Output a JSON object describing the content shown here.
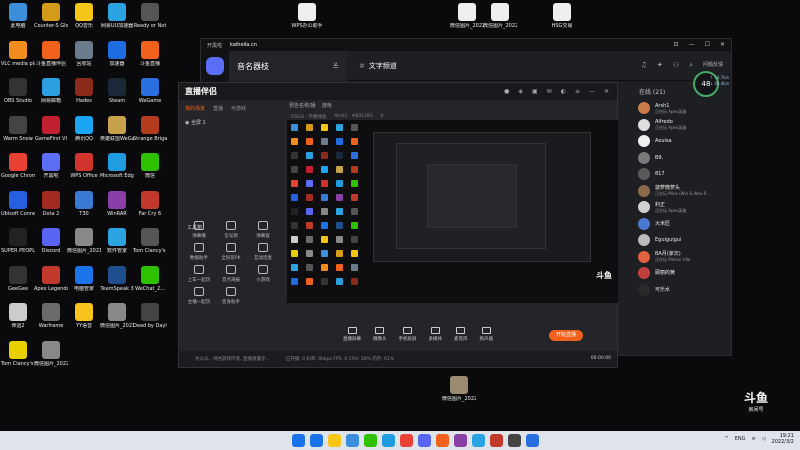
{
  "desktop": {
    "icons": [
      {
        "label": "此电脑",
        "color": "#3b8ed9"
      },
      {
        "label": "Counter-S Global Off...",
        "color": "#d49b1a"
      },
      {
        "label": "QQ音乐",
        "color": "#f5c518"
      },
      {
        "label": "网易UU加速器",
        "color": "#2aa3e0"
      },
      {
        "label": "Ready or Not",
        "color": "#555"
      },
      {
        "label": "VLC media player",
        "color": "#f28c1e"
      },
      {
        "label": "斗鱼直播伴侣",
        "color": "#f0611c"
      },
      {
        "label": "回收站",
        "color": "#6a7b8e"
      },
      {
        "label": "加速器",
        "color": "#1e6de0"
      },
      {
        "label": "斗鱼直播",
        "color": "#f0611c"
      },
      {
        "label": "OBS Studio",
        "color": "#333"
      },
      {
        "label": "网易邮箱",
        "color": "#2b9fe0"
      },
      {
        "label": "Hades",
        "color": "#8a2a1a"
      },
      {
        "label": "Steam",
        "color": "#1b2838"
      },
      {
        "label": "WeGame",
        "color": "#2a6fe0"
      },
      {
        "label": "Warm Snow",
        "color": "#444"
      },
      {
        "label": "GameFirst VI",
        "color": "#c02030"
      },
      {
        "label": "腾讯QQ",
        "color": "#1ba5f5"
      },
      {
        "label": "英雄联盟WeGame版",
        "color": "#c8a24a"
      },
      {
        "label": "Strange Brigade",
        "color": "#b43c1e"
      },
      {
        "label": "Google Chrome",
        "color": "#e94235"
      },
      {
        "label": "开黑啦",
        "color": "#5b6ef5"
      },
      {
        "label": "WPS Office",
        "color": "#d0342c"
      },
      {
        "label": "Microsoft Edge",
        "color": "#1f9de0"
      },
      {
        "label": "微信",
        "color": "#2dc100"
      },
      {
        "label": "Ubisoft Connect",
        "color": "#2560e0"
      },
      {
        "label": "Dota 2",
        "color": "#a32a20"
      },
      {
        "label": "T30",
        "color": "#3a7bd5"
      },
      {
        "label": "WinRAR",
        "color": "#8a3fa6"
      },
      {
        "label": "Far Cry 6",
        "color": "#c0392b"
      },
      {
        "label": "SUPER PEOPLE CBT",
        "color": "#222"
      },
      {
        "label": "Discord",
        "color": "#5865f2"
      },
      {
        "label": "微信图片_2021112...",
        "color": "#888"
      },
      {
        "label": "软件管家",
        "color": "#2aa3e0"
      },
      {
        "label": "Tom Clancy's R...",
        "color": "#555"
      },
      {
        "label": "GeeGee",
        "color": "#333"
      },
      {
        "label": "Apex Legends",
        "color": "#c0392b"
      },
      {
        "label": "电脑管家",
        "color": "#1a73e8"
      },
      {
        "label": "TeamSpeak 3",
        "color": "#1f4e8c"
      },
      {
        "label": "WeChat_2...",
        "color": "#2dc100"
      },
      {
        "label": "命运2",
        "color": "#ccc"
      },
      {
        "label": "Warframe",
        "color": "#6a6a6a"
      },
      {
        "label": "YY语音",
        "color": "#f6c21c"
      },
      {
        "label": "微信图片_2021120...",
        "color": "#888"
      },
      {
        "label": "Dead by Daylight",
        "color": "#444"
      },
      {
        "label": "Tom Clancy's R...",
        "color": "#e8d000"
      },
      {
        "label": "微信图片_2022020...",
        "color": "#888"
      }
    ],
    "top_files": [
      {
        "label": "WPS办公助手"
      },
      {
        "label": "微信图片_2022030..."
      },
      {
        "label": "微信图片_2022030..."
      },
      {
        "label": "HSG交易"
      }
    ],
    "bottom_file": {
      "label": "微信图片_2022020..."
    },
    "bg_text": "NG",
    "bg_text2": "G"
  },
  "kaiheila": {
    "app_name": "开黑啦",
    "url": "kaiheila.cn",
    "server_name": "音名器枝",
    "channel_name": "文字频道",
    "help_label": "问题反馈",
    "ping": "48",
    "net_up": "↑ 14.7k/s",
    "net_down": "↓ 48.4k/s",
    "online_header": "在线 (21)",
    "members": [
      {
        "name": "Arsh1",
        "status": "正在玩 Apex英雄",
        "color": "#c97b4a"
      },
      {
        "name": "Alfredo",
        "status": "正在玩 Apex英雄",
        "color": "#e0e0e0"
      },
      {
        "name": "Aoulsa",
        "status": "",
        "color": "#f0f0f0"
      },
      {
        "name": "B9.",
        "status": "",
        "color": "#7a7a7a"
      },
      {
        "name": "817",
        "status": "",
        "color": "#5a5a5a"
      },
      {
        "name": "菠萝微萝头",
        "status": "正在玩 Mine (Win & Wsu R...",
        "color": "#8a6a4a"
      },
      {
        "name": "利正",
        "status": "正在玩 Apex英雄",
        "color": "#d0d0d0"
      },
      {
        "name": "大米匠",
        "status": "",
        "color": "#4a7ad0"
      },
      {
        "name": "Eguiguigui",
        "status": "",
        "color": "#bbbbbb"
      },
      {
        "name": "BA月(家次)",
        "status": "正在玩 Melvor Idle",
        "color": "#e06040"
      },
      {
        "name": "顾丽的黄",
        "status": "",
        "color": "#c04040"
      },
      {
        "name": "可乐水",
        "status": "",
        "color": "#2a2a2a"
      }
    ]
  },
  "douyu": {
    "logo": "直播伴侣",
    "tabs": [
      "我的场景",
      "直播",
      "可游戏"
    ],
    "scene": "全屏 1",
    "stage_tabs": [
      "预告名称/播",
      "游戏"
    ],
    "stage_info": [
      "CSGO · 不想体验",
      "Arsh1 · #831393",
      "0"
    ],
    "tools_title": "工具箱",
    "tools": [
      {
        "label": "弹幕播"
      },
      {
        "label": "信号源"
      },
      {
        "label": "弹幕窗"
      },
      {
        "label": "数据助手"
      },
      {
        "label": "全民玩PK"
      },
      {
        "label": "互动连麦"
      },
      {
        "label": "上车一起玩"
      },
      {
        "label": "音点海报"
      },
      {
        "label": "小游戏"
      },
      {
        "label": "主播一起玩"
      },
      {
        "label": "变身助手"
      }
    ],
    "bottom_buttons": [
      {
        "label": "直播屏幕"
      },
      {
        "label": "摄像头"
      },
      {
        "label": "手机投屏"
      },
      {
        "label": "多媒体"
      },
      {
        "label": "麦克风"
      },
      {
        "label": "扬声器"
      }
    ],
    "go_live": "开始直播",
    "status_items": [
      "已开播: 0",
      "码率: 0kbps",
      "FPS: 0",
      "CPU: 30%",
      "内存: 61%"
    ],
    "timer": "00:00:00",
    "notice": "为公众、绿色游戏环境, 直播请遵守..."
  },
  "taskbar": {
    "lang": "ENG",
    "time": "19:21",
    "date": "2022/3/2",
    "app_colors": [
      "#1a73e8",
      "#f5c518",
      "#3b8ed9",
      "#2dc100",
      "#1f9de0",
      "#e94235",
      "#5865f2",
      "#f0611c",
      "#8a3fa6",
      "#2aa3e0",
      "#c0392b",
      "#444",
      "#2a6fe0"
    ]
  },
  "watermark": {
    "main": "斗鱼",
    "sub": "房间号"
  }
}
